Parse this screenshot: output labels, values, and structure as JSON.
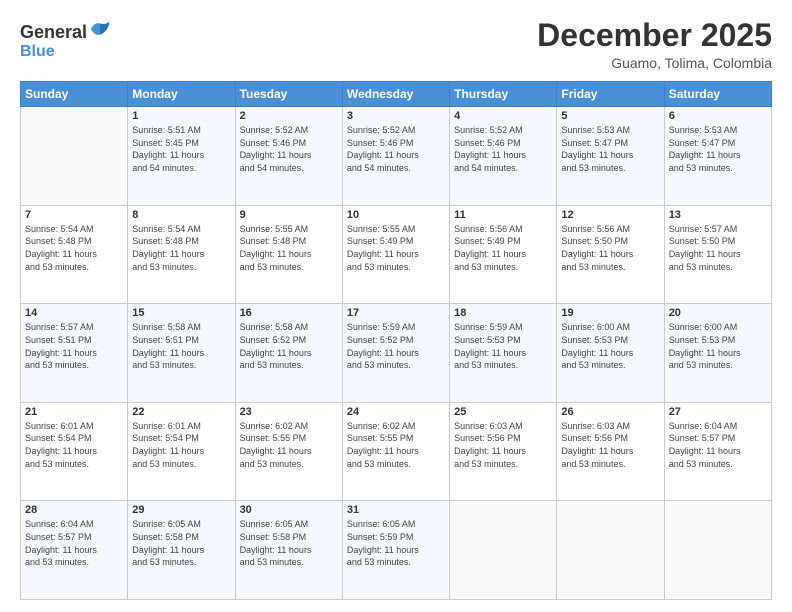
{
  "logo": {
    "general": "General",
    "blue": "Blue"
  },
  "header": {
    "month": "December 2025",
    "location": "Guamo, Tolima, Colombia"
  },
  "weekdays": [
    "Sunday",
    "Monday",
    "Tuesday",
    "Wednesday",
    "Thursday",
    "Friday",
    "Saturday"
  ],
  "weeks": [
    [
      {
        "day": "",
        "info": ""
      },
      {
        "day": "1",
        "info": "Sunrise: 5:51 AM\nSunset: 5:45 PM\nDaylight: 11 hours\nand 54 minutes."
      },
      {
        "day": "2",
        "info": "Sunrise: 5:52 AM\nSunset: 5:46 PM\nDaylight: 11 hours\nand 54 minutes."
      },
      {
        "day": "3",
        "info": "Sunrise: 5:52 AM\nSunset: 5:46 PM\nDaylight: 11 hours\nand 54 minutes."
      },
      {
        "day": "4",
        "info": "Sunrise: 5:52 AM\nSunset: 5:46 PM\nDaylight: 11 hours\nand 54 minutes."
      },
      {
        "day": "5",
        "info": "Sunrise: 5:53 AM\nSunset: 5:47 PM\nDaylight: 11 hours\nand 53 minutes."
      },
      {
        "day": "6",
        "info": "Sunrise: 5:53 AM\nSunset: 5:47 PM\nDaylight: 11 hours\nand 53 minutes."
      }
    ],
    [
      {
        "day": "7",
        "info": "Sunrise: 5:54 AM\nSunset: 5:48 PM\nDaylight: 11 hours\nand 53 minutes."
      },
      {
        "day": "8",
        "info": "Sunrise: 5:54 AM\nSunset: 5:48 PM\nDaylight: 11 hours\nand 53 minutes."
      },
      {
        "day": "9",
        "info": "Sunrise: 5:55 AM\nSunset: 5:48 PM\nDaylight: 11 hours\nand 53 minutes."
      },
      {
        "day": "10",
        "info": "Sunrise: 5:55 AM\nSunset: 5:49 PM\nDaylight: 11 hours\nand 53 minutes."
      },
      {
        "day": "11",
        "info": "Sunrise: 5:56 AM\nSunset: 5:49 PM\nDaylight: 11 hours\nand 53 minutes."
      },
      {
        "day": "12",
        "info": "Sunrise: 5:56 AM\nSunset: 5:50 PM\nDaylight: 11 hours\nand 53 minutes."
      },
      {
        "day": "13",
        "info": "Sunrise: 5:57 AM\nSunset: 5:50 PM\nDaylight: 11 hours\nand 53 minutes."
      }
    ],
    [
      {
        "day": "14",
        "info": "Sunrise: 5:57 AM\nSunset: 5:51 PM\nDaylight: 11 hours\nand 53 minutes."
      },
      {
        "day": "15",
        "info": "Sunrise: 5:58 AM\nSunset: 5:51 PM\nDaylight: 11 hours\nand 53 minutes."
      },
      {
        "day": "16",
        "info": "Sunrise: 5:58 AM\nSunset: 5:52 PM\nDaylight: 11 hours\nand 53 minutes."
      },
      {
        "day": "17",
        "info": "Sunrise: 5:59 AM\nSunset: 5:52 PM\nDaylight: 11 hours\nand 53 minutes."
      },
      {
        "day": "18",
        "info": "Sunrise: 5:59 AM\nSunset: 5:53 PM\nDaylight: 11 hours\nand 53 minutes."
      },
      {
        "day": "19",
        "info": "Sunrise: 6:00 AM\nSunset: 5:53 PM\nDaylight: 11 hours\nand 53 minutes."
      },
      {
        "day": "20",
        "info": "Sunrise: 6:00 AM\nSunset: 5:53 PM\nDaylight: 11 hours\nand 53 minutes."
      }
    ],
    [
      {
        "day": "21",
        "info": "Sunrise: 6:01 AM\nSunset: 5:54 PM\nDaylight: 11 hours\nand 53 minutes."
      },
      {
        "day": "22",
        "info": "Sunrise: 6:01 AM\nSunset: 5:54 PM\nDaylight: 11 hours\nand 53 minutes."
      },
      {
        "day": "23",
        "info": "Sunrise: 6:02 AM\nSunset: 5:55 PM\nDaylight: 11 hours\nand 53 minutes."
      },
      {
        "day": "24",
        "info": "Sunrise: 6:02 AM\nSunset: 5:55 PM\nDaylight: 11 hours\nand 53 minutes."
      },
      {
        "day": "25",
        "info": "Sunrise: 6:03 AM\nSunset: 5:56 PM\nDaylight: 11 hours\nand 53 minutes."
      },
      {
        "day": "26",
        "info": "Sunrise: 6:03 AM\nSunset: 5:56 PM\nDaylight: 11 hours\nand 53 minutes."
      },
      {
        "day": "27",
        "info": "Sunrise: 6:04 AM\nSunset: 5:57 PM\nDaylight: 11 hours\nand 53 minutes."
      }
    ],
    [
      {
        "day": "28",
        "info": "Sunrise: 6:04 AM\nSunset: 5:57 PM\nDaylight: 11 hours\nand 53 minutes."
      },
      {
        "day": "29",
        "info": "Sunrise: 6:05 AM\nSunset: 5:58 PM\nDaylight: 11 hours\nand 53 minutes."
      },
      {
        "day": "30",
        "info": "Sunrise: 6:05 AM\nSunset: 5:58 PM\nDaylight: 11 hours\nand 53 minutes."
      },
      {
        "day": "31",
        "info": "Sunrise: 6:05 AM\nSunset: 5:59 PM\nDaylight: 11 hours\nand 53 minutes."
      },
      {
        "day": "",
        "info": ""
      },
      {
        "day": "",
        "info": ""
      },
      {
        "day": "",
        "info": ""
      }
    ]
  ]
}
